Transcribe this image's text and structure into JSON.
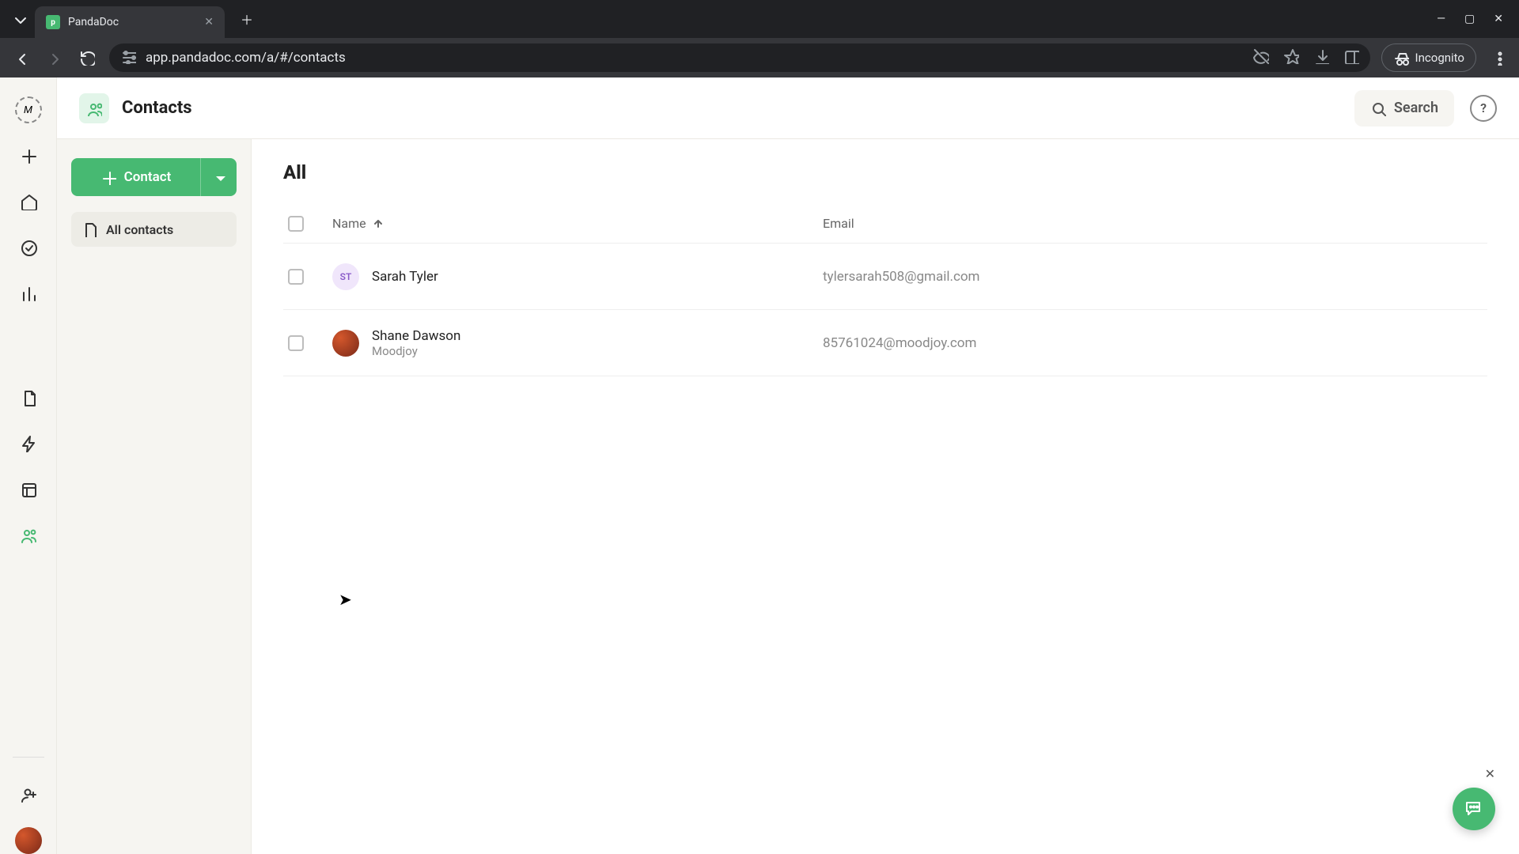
{
  "browser": {
    "tab_title": "PandaDoc",
    "url": "app.pandadoc.com/a/#/contacts",
    "incognito_label": "Incognito"
  },
  "topbar": {
    "title": "Contacts",
    "search_label": "Search"
  },
  "sidebar": {
    "contact_button": "Contact",
    "all_contacts": "All contacts"
  },
  "content": {
    "heading": "All",
    "col_name": "Name",
    "col_email": "Email",
    "rows": [
      {
        "initials": "ST",
        "name": "Sarah Tyler",
        "company": "",
        "email": "tylersarah508@gmail.com"
      },
      {
        "initials": "",
        "name": "Shane Dawson",
        "company": "Moodjoy",
        "email": "85761024@moodjoy.com"
      }
    ]
  }
}
